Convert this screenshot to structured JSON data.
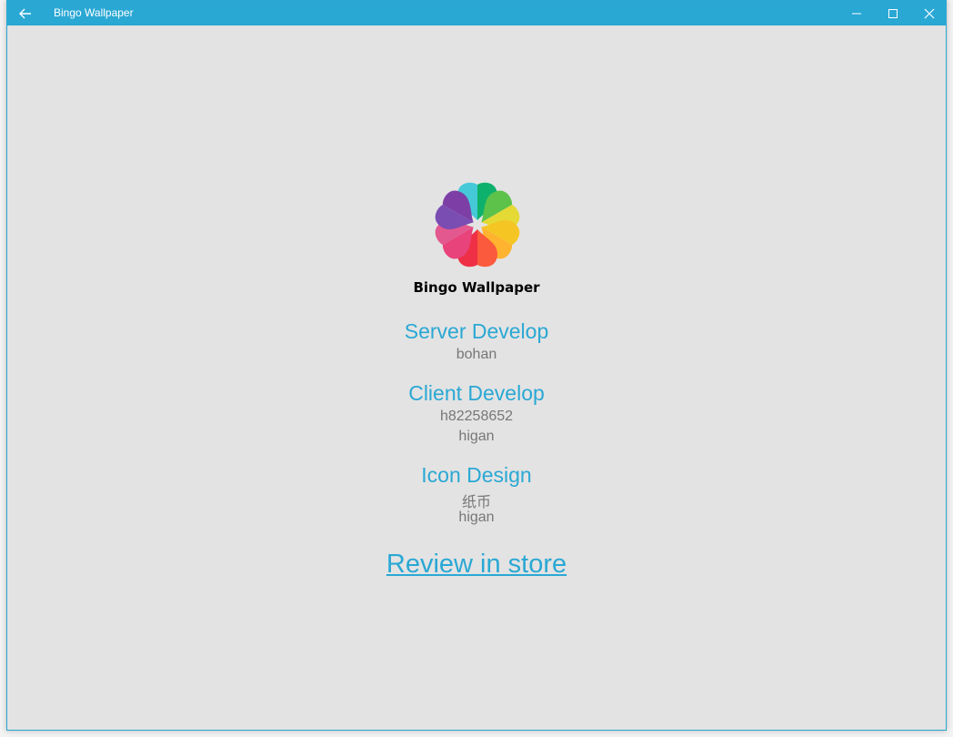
{
  "window": {
    "title": "Bingo Wallpaper",
    "accent_color": "#2aa8d4",
    "back_icon": "back-arrow-icon",
    "minimize_icon": "minimize-icon",
    "maximize_icon": "maximize-icon",
    "close_icon": "close-icon"
  },
  "about": {
    "logo_icon": "flower-logo-icon",
    "app_name": "Bingo Wallpaper",
    "sections": [
      {
        "title": "Server Develop",
        "credits": [
          "bohan"
        ]
      },
      {
        "title": "Client Develop",
        "credits": [
          "h82258652",
          "higan"
        ]
      },
      {
        "title": "Icon Design",
        "credits": [
          "纸币",
          "higan"
        ]
      }
    ],
    "review_link": "Review in store"
  }
}
